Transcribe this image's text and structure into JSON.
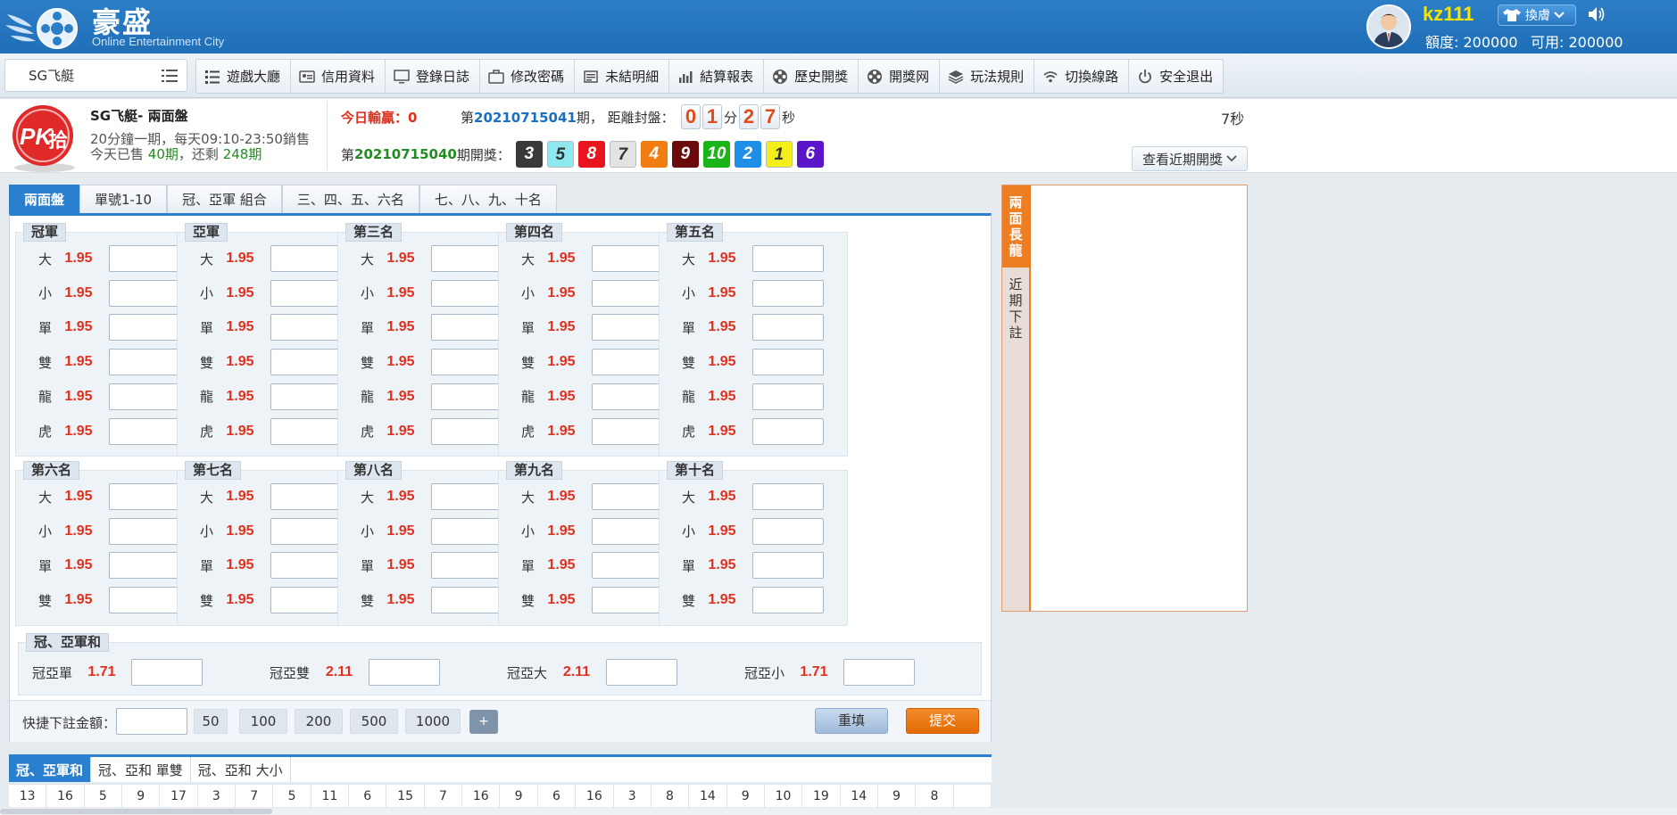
{
  "header": {
    "brand": "豪盛",
    "subtitle": "Online Entertainment City",
    "username": "kz111",
    "skin_label": "換膚",
    "quota": "額度: 200000",
    "available": "可用: 200000"
  },
  "nav": {
    "game_select": "SG飞艇",
    "items": [
      "遊戲大廳",
      "信用資料",
      "登錄日誌",
      "修改密碼",
      "未結明細",
      "結算報表",
      "歷史開獎",
      "開獎网",
      "玩法規則",
      "切換線路",
      "安全退出"
    ]
  },
  "game_info": {
    "name": "SG飞艇- 兩面盤",
    "schedule": "20分鐘一期，每天09:10-23:50銷售",
    "sold_prefix": "今天已售",
    "sold": "40期",
    "sold_mid": "，还剩",
    "remaining": "248期",
    "today_win": "今日輸贏：0",
    "period_prefix": "第",
    "current_period": "20210715041",
    "period_suffix": "期，  距離封盤：",
    "countdown_digits": [
      "0",
      "1",
      "2",
      "7"
    ],
    "min_label": "分",
    "sec_label": "秒",
    "right_seconds": "7秒",
    "last_prefix": "第",
    "last_period": "20210715040",
    "last_suffix": "期開獎：",
    "draw_numbers": [
      {
        "n": "3",
        "bg": "#3a3a3a",
        "fg": "#ffffff"
      },
      {
        "n": "5",
        "bg": "#8ee8f0",
        "fg": "#333333"
      },
      {
        "n": "8",
        "bg": "#e8141e",
        "fg": "#ffffff"
      },
      {
        "n": "7",
        "bg": "#e3e3e3",
        "fg": "#333333"
      },
      {
        "n": "4",
        "bg": "#f07c12",
        "fg": "#ffffff"
      },
      {
        "n": "9",
        "bg": "#6b0a0a",
        "fg": "#ffffff"
      },
      {
        "n": "10",
        "bg": "#18b418",
        "fg": "#ffffff"
      },
      {
        "n": "2",
        "bg": "#1e8fe8",
        "fg": "#ffffff"
      },
      {
        "n": "1",
        "bg": "#f3ef18",
        "fg": "#333333"
      },
      {
        "n": "6",
        "bg": "#5a16c8",
        "fg": "#ffffff"
      }
    ],
    "recent_btn": "查看近期開獎"
  },
  "tabs": [
    "兩面盤",
    "單號1-10",
    "冠、亞軍 組合",
    "三、四、五、六名",
    "七、八、九、十名"
  ],
  "groups_top": [
    {
      "title": "冠軍"
    },
    {
      "title": "亞軍"
    },
    {
      "title": "第三名"
    },
    {
      "title": "第四名"
    },
    {
      "title": "第五名"
    }
  ],
  "groups_bottom": [
    {
      "title": "第六名"
    },
    {
      "title": "第七名"
    },
    {
      "title": "第八名"
    },
    {
      "title": "第九名"
    },
    {
      "title": "第十名"
    }
  ],
  "top_options": [
    {
      "label": "大",
      "odds": "1.95"
    },
    {
      "label": "小",
      "odds": "1.95"
    },
    {
      "label": "單",
      "odds": "1.95"
    },
    {
      "label": "雙",
      "odds": "1.95"
    },
    {
      "label": "龍",
      "odds": "1.95"
    },
    {
      "label": "虎",
      "odds": "1.95"
    }
  ],
  "bottom_options": [
    {
      "label": "大",
      "odds": "1.95"
    },
    {
      "label": "小",
      "odds": "1.95"
    },
    {
      "label": "單",
      "odds": "1.95"
    },
    {
      "label": "雙",
      "odds": "1.95"
    }
  ],
  "sum_group": {
    "title": "冠、亞軍和",
    "options": [
      {
        "label": "冠亞單",
        "odds": "1.71"
      },
      {
        "label": "冠亞雙",
        "odds": "2.11"
      },
      {
        "label": "冠亞大",
        "odds": "2.11"
      },
      {
        "label": "冠亞小",
        "odds": "1.71"
      }
    ]
  },
  "quick_bet": {
    "label": "快捷下註金額：",
    "amounts": [
      "50",
      "100",
      "200",
      "500",
      "1000"
    ],
    "plus": "+",
    "reset": "重填",
    "submit": "提交"
  },
  "side_panel": {
    "tabs": [
      "兩面長龍",
      "近期下註"
    ]
  },
  "bottom_stats": {
    "tabs": [
      "冠、亞軍和",
      "冠、亞和 單雙",
      "冠、亞和 大小"
    ],
    "values": [
      "13",
      "16",
      "5",
      "9",
      "17",
      "3",
      "7",
      "5",
      "11",
      "6",
      "15",
      "7",
      "16",
      "9",
      "6",
      "16",
      "3",
      "8",
      "14",
      "9",
      "10",
      "19",
      "14",
      "9",
      "8",
      ""
    ]
  }
}
